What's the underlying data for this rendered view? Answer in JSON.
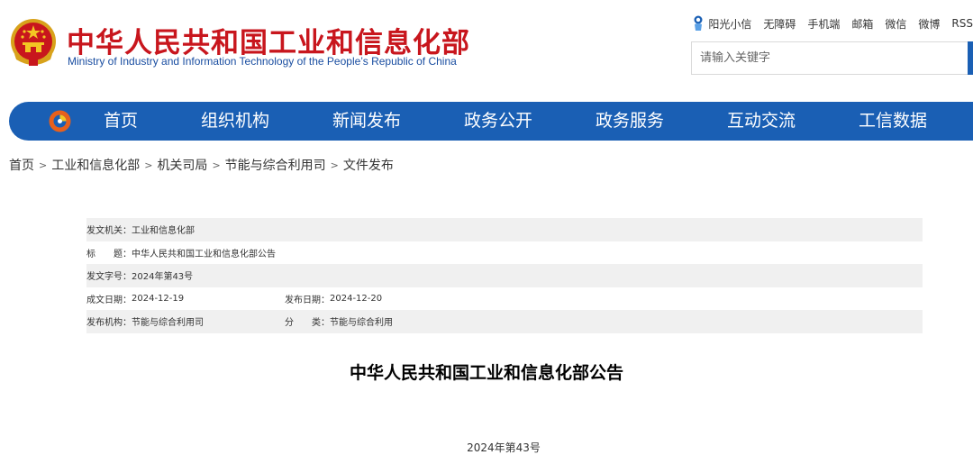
{
  "header": {
    "title": "中华人民共和国工业和信息化部",
    "subtitle": "Ministry of Industry and Information Technology of the People’s Republic of China",
    "top_links": [
      "阳光小信",
      "无障碍",
      "手机端",
      "邮箱",
      "微信",
      "微博",
      "RSS"
    ],
    "search_placeholder": "请输入关键字"
  },
  "nav": {
    "items": [
      "首页",
      "组织机构",
      "新闻发布",
      "政务公开",
      "政务服务",
      "互动交流",
      "工信数据"
    ]
  },
  "breadcrumb": [
    "首页",
    "工业和信息化部",
    "机关司局",
    "节能与综合利用司",
    "文件发布"
  ],
  "info": {
    "issuer_label": "发文机关：",
    "issuer": "工业和信息化部",
    "title_label": "标　　题：",
    "title": "中华人民共和国工业和信息化部公告",
    "doc_no_label": "发文字号：",
    "doc_no": "2024年第43号",
    "created_label": "成文日期：",
    "created": "2024-12-19",
    "published_label": "发布日期：",
    "published": "2024-12-20",
    "org_label": "发布机构：",
    "org": "节能与综合利用司",
    "category_label": "分　　类：",
    "category": "节能与综合利用"
  },
  "article": {
    "title": "中华人民共和国工业和信息化部公告",
    "number": "2024年第43号"
  },
  "colors": {
    "brand_red": "#c8161d",
    "brand_blue": "#1a5fb4",
    "subtitle_blue": "#1a4ea1",
    "row_shade": "#f0f0f0"
  }
}
